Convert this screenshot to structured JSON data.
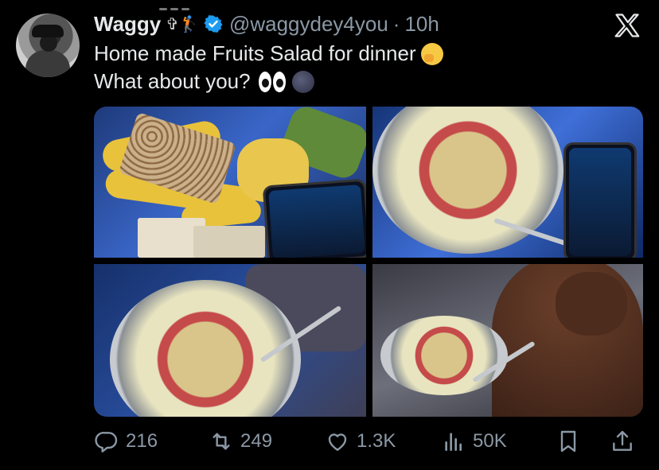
{
  "tweet": {
    "display_name": "Waggy",
    "name_emojis": "✞🏌",
    "handle": "@waggydey4you",
    "separator": "·",
    "time": "10h",
    "text_line1": "Home made Fruits Salad for dinner",
    "text_line2": "What about you?"
  },
  "actions": {
    "replies": "216",
    "retweets": "249",
    "likes": "1.3K",
    "views": "50K"
  },
  "icons": {
    "verified": "verified-badge-icon",
    "close": "x-logo-icon",
    "reply": "reply-icon",
    "retweet": "retweet-icon",
    "like": "heart-icon",
    "views": "views-icon",
    "bookmark": "bookmark-icon",
    "share": "share-icon"
  },
  "colors": {
    "background": "#000000",
    "text": "#e7e9ea",
    "muted": "#8b98a5",
    "verified": "#1d9bf0"
  }
}
